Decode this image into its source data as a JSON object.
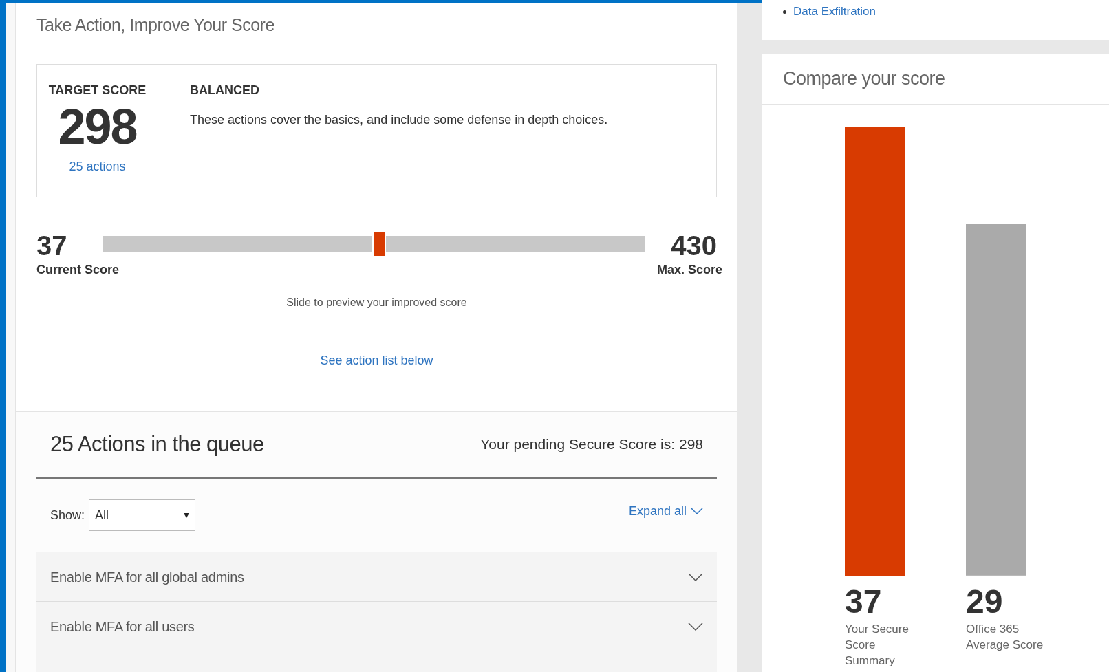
{
  "top_card": {
    "bullet_item": "Data Exfiltration"
  },
  "action_panel": {
    "title": "Take Action, Improve Your Score",
    "target": {
      "label": "TARGET SCORE",
      "score": "298",
      "actions_link": "25 actions"
    },
    "plan": {
      "title": "BALANCED",
      "description": "These actions cover the basics, and include some defense in depth choices."
    },
    "slider": {
      "current_value": "37",
      "current_label": "Current Score",
      "max_value": "430",
      "max_label": "Max. Score",
      "level": 0.51,
      "hint": "Slide to preview your improved score"
    },
    "see_list_link": "See action list below"
  },
  "queue": {
    "title": "25 Actions in the queue",
    "pending": "Your pending Secure Score is: 298",
    "filter": {
      "label": "Show:",
      "value": "All"
    },
    "expand_all": "Expand all",
    "actions": [
      {
        "name": "Enable MFA for all global admins",
        "expanded": false
      },
      {
        "name": "Enable MFA for all users",
        "expanded": false
      }
    ]
  },
  "compare": {
    "title": "Compare your score",
    "chart_data": {
      "type": "bar",
      "categories": [
        "Your Secure Score Summary",
        "Office 365 Average Score"
      ],
      "values": [
        37,
        29
      ],
      "colors": [
        "#d83b01",
        "#aaaaaa"
      ],
      "data_labels": true,
      "value_labels": [
        "37",
        "29"
      ]
    }
  }
}
